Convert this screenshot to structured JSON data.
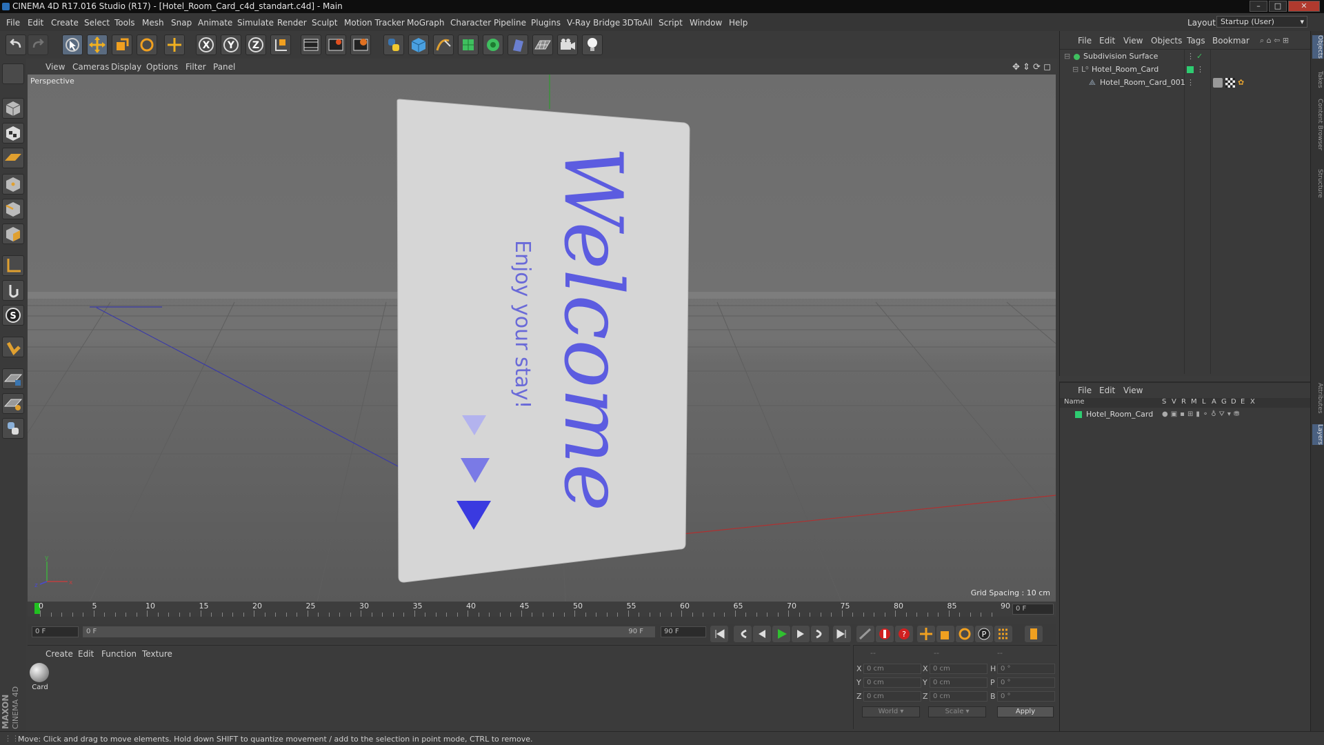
{
  "title_bar": {
    "text": "CINEMA 4D R17.016 Studio (R17) - [Hotel_Room_Card_c4d_standart.c4d] - Main"
  },
  "menu": [
    "File",
    "Edit",
    "Create",
    "Select",
    "Tools",
    "Mesh",
    "Snap",
    "Animate",
    "Simulate",
    "Render",
    "Sculpt",
    "Motion Tracker",
    "MoGraph",
    "Character",
    "Pipeline",
    "Plugins",
    "V-Ray Bridge",
    "3DToAll",
    "Script",
    "Window",
    "Help"
  ],
  "layout": {
    "label": "Layout:",
    "value": "Startup (User)"
  },
  "viewport": {
    "menu": [
      "View",
      "Cameras",
      "Display",
      "Options",
      "Filter",
      "Panel"
    ],
    "label": "Perspective",
    "grid_spacing": "Grid Spacing : 10 cm",
    "card": {
      "title": "Welcome",
      "subtitle": "Enjoy your stay!"
    },
    "axis": {
      "x": "x",
      "y": "y",
      "z": "z"
    }
  },
  "timeline": {
    "ticks": [
      "0",
      "5",
      "10",
      "15",
      "20",
      "25",
      "30",
      "35",
      "40",
      "45",
      "50",
      "55",
      "60",
      "65",
      "70",
      "75",
      "80",
      "85",
      "90"
    ],
    "current_frame": "0 F",
    "start": "0 F",
    "slider_start": "0 F",
    "slider_end": "90 F",
    "end": "90 F"
  },
  "material_manager": {
    "menu": [
      "Create",
      "Edit",
      "Function",
      "Texture"
    ],
    "materials": [
      {
        "name": "Card"
      }
    ]
  },
  "coordinates": {
    "header": [
      "--",
      "--",
      "--"
    ],
    "rows": [
      {
        "a": "X",
        "av": "0 cm",
        "b": "X",
        "bv": "0 cm",
        "c": "H",
        "cv": "0 °"
      },
      {
        "a": "Y",
        "av": "0 cm",
        "b": "Y",
        "bv": "0 cm",
        "c": "P",
        "cv": "0 °"
      },
      {
        "a": "Z",
        "av": "0 cm",
        "b": "Z",
        "bv": "0 cm",
        "c": "B",
        "cv": "0 °"
      }
    ],
    "mode": "World",
    "transform": "Scale",
    "apply": "Apply"
  },
  "object_manager": {
    "menu": [
      "File",
      "Edit",
      "View",
      "Objects",
      "Tags",
      "Bookmar"
    ],
    "objects": [
      {
        "name": "Subdivision Surface",
        "indent": 0
      },
      {
        "name": "Hotel_Room_Card",
        "indent": 1
      },
      {
        "name": "Hotel_Room_Card_001",
        "indent": 2
      }
    ]
  },
  "layer_manager": {
    "menu": [
      "File",
      "Edit",
      "View"
    ],
    "columns": [
      "Name",
      "S",
      "V",
      "R",
      "M",
      "L",
      "A",
      "G",
      "D",
      "E",
      "X"
    ],
    "layers": [
      {
        "name": "Hotel_Room_Card",
        "color": "#2ecc71"
      }
    ]
  },
  "side_tabs": [
    "Objects",
    "Takes",
    "Content Browser",
    "Structure",
    "Attributes",
    "Layers"
  ],
  "status": {
    "text": "Move: Click and drag to move elements. Hold down SHIFT to quantize movement / add to the selection in point mode, CTRL to remove."
  },
  "brand": {
    "line1": "MAXON",
    "line2": "CINEMA 4D"
  },
  "colors": {
    "accent": "#4a4aff",
    "object_green": "#2ecc71"
  }
}
